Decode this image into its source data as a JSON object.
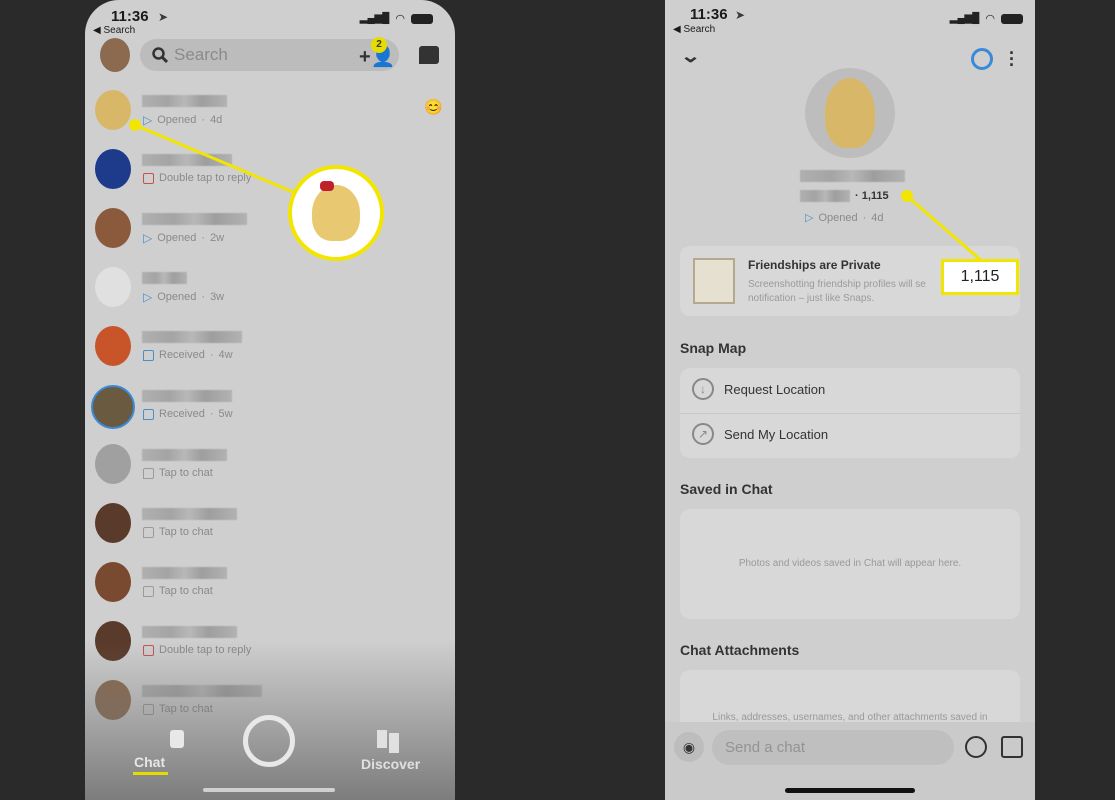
{
  "left": {
    "status_bar": {
      "time": "11:36",
      "back": "◀ Search"
    },
    "search": {
      "placeholder": "Search",
      "friend_requests_badge": "2"
    },
    "chats": [
      {
        "status": "Opened",
        "age": "4d",
        "icon": "sent-arrow-icon",
        "color": "#4a90c8",
        "emoji": "😊"
      },
      {
        "status": "Double tap to reply",
        "age": "",
        "icon": "square-outline-icon",
        "color": "#c85050"
      },
      {
        "status": "Opened",
        "age": "2w",
        "icon": "sent-arrow-icon",
        "color": "#4a90c8"
      },
      {
        "status": "Opened",
        "age": "3w",
        "icon": "sent-arrow-icon",
        "color": "#4a90c8"
      },
      {
        "status": "Received",
        "age": "4w",
        "icon": "chat-bubble-icon",
        "color": "#4a90c8"
      },
      {
        "status": "Received",
        "age": "5w",
        "icon": "chat-bubble-icon",
        "color": "#4a90c8"
      },
      {
        "status": "Tap to chat",
        "age": "",
        "icon": "chat-bubble-icon",
        "color": "#9a9a9a"
      },
      {
        "status": "Tap to chat",
        "age": "",
        "icon": "chat-bubble-icon",
        "color": "#9a9a9a"
      },
      {
        "status": "Tap to chat",
        "age": "",
        "icon": "chat-bubble-icon",
        "color": "#9a9a9a"
      },
      {
        "status": "Double tap to reply",
        "age": "",
        "icon": "square-outline-icon",
        "color": "#c85050"
      },
      {
        "status": "Tap to chat",
        "age": "",
        "icon": "square-outline-icon",
        "color": "#9a9a9a"
      }
    ],
    "nav": {
      "chat": "Chat",
      "discover": "Discover"
    },
    "accent": "#f2e600"
  },
  "right": {
    "status_bar": {
      "time": "11:36",
      "back": "◀ Search"
    },
    "profile": {
      "score": "1,115",
      "status": "Opened",
      "age": "4d"
    },
    "friendship": {
      "title": "Friendships are Private",
      "body": "Screenshotting friendship profiles will se",
      "body2": "notification – just like Snaps."
    },
    "callout_value": "1,115",
    "snap_map": {
      "title": "Snap Map",
      "request": "Request Location",
      "send": "Send My Location"
    },
    "saved": {
      "title": "Saved in Chat",
      "empty": "Photos and videos saved in Chat will appear here."
    },
    "attachments": {
      "title": "Chat Attachments",
      "empty": "Links, addresses, usernames, and other attachments saved in"
    },
    "composer": {
      "placeholder": "Send a chat"
    }
  }
}
